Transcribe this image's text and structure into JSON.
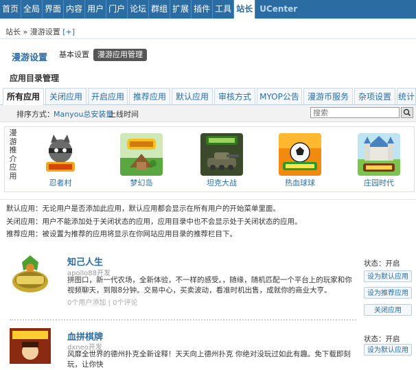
{
  "topnav": {
    "items": [
      "首页",
      "全局",
      "界面",
      "内容",
      "用户",
      "门户",
      "论坛",
      "群组",
      "扩展",
      "插件",
      "工具",
      "站长",
      "UCenter"
    ],
    "active_index": 11
  },
  "breadcrumb": {
    "root": "站长",
    "sep": "»",
    "current": "漫游设置",
    "plus": "[+]"
  },
  "page": {
    "title": "漫游设置",
    "subtabs": [
      "基本设置",
      "漫游应用管理"
    ],
    "active_subtab": 1,
    "section_title": "应用目录管理"
  },
  "tabs": {
    "items": [
      "所有应用",
      "关闭应用",
      "开启应用",
      "推荐应用",
      "默认应用",
      "审核方式",
      "MYOP公告",
      "漫游币服务",
      "杂项设置",
      "统计"
    ],
    "active_index": 0
  },
  "sort": {
    "label": "排序方式：",
    "options": [
      "Manyou总安装量",
      "上线时间"
    ],
    "active_index": 0,
    "search_placeholder": "搜索"
  },
  "recommend": {
    "label": "漫游推介应用",
    "apps": [
      "忍者村",
      "梦幻岛",
      "坦克大战",
      "热血球球",
      "庄园时代"
    ]
  },
  "legend": [
    "默认应用：无论用户是否添加此应用，默认应用都会显示在所有用户的开始菜单里面。",
    "关闭应用：用户不能添加处于关闭状态的应用，应用目录中也不会显示处于关闭状态的应用。",
    "推荐应用：被设置为推荐的应用将显示在你网站应用目录的推荐栏目下。"
  ],
  "apps": [
    {
      "name": "知己人生",
      "dev": "apollo88开发",
      "desc": "拼图口，新一代农场，全新体验，不一样的感受。，随缘，随机匹配一个平台上的玩家和你视频聊天，到限8分钟。交易中心，买卖波动，看准时机出售，成就你的商业大亨。",
      "meta": "0个用户添加 | 0个评论",
      "status": "状态：开启",
      "buttons": [
        "设为默认应用",
        "设为推荐应用",
        "关闭应用"
      ]
    },
    {
      "name": "血拼棋牌",
      "dev": "dxneo开发",
      "desc": "风靡全世界的德州扑克全新诠释！天天向上德州扑克 你绝对没玩过如此有趣。免下载即刻玩，让你快",
      "meta": "",
      "status": "状态：开启",
      "buttons": [
        "设为默认应用"
      ]
    }
  ],
  "colors": {
    "nav_bg": "#2b6ca3",
    "link": "#2b6ca3",
    "active_subtab": "#555555"
  }
}
